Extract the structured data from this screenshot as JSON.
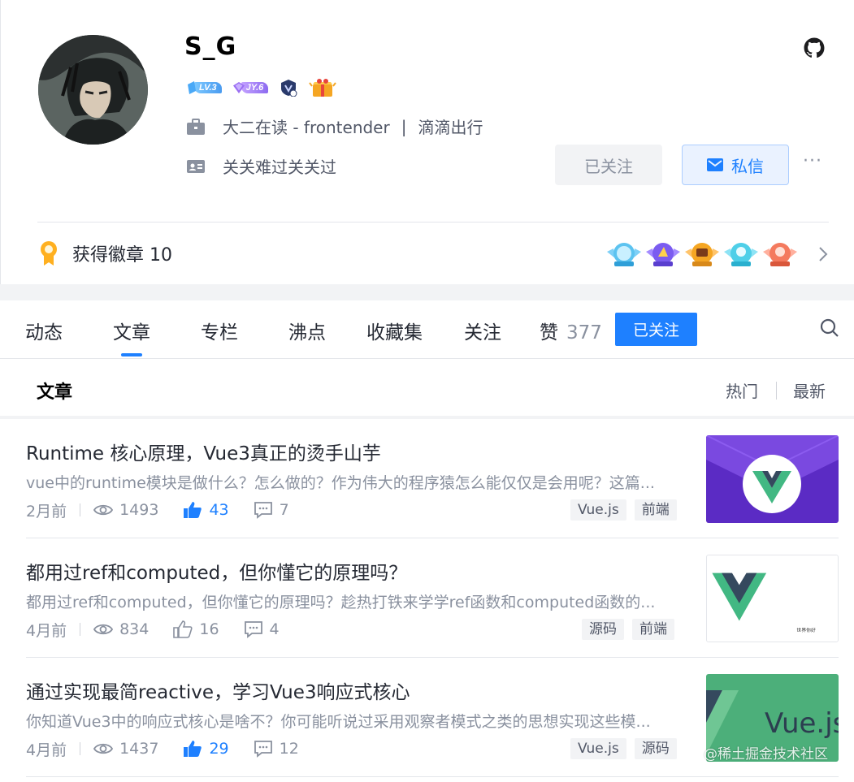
{
  "profile": {
    "username": "S_G",
    "level_badge": "LV.3",
    "jy_badge": "JY.6",
    "job": {
      "title": "大二在读 - frontender",
      "separator": "|",
      "company": "滴滴出行"
    },
    "bio": "关关难过关关过",
    "followed_label": "已关注",
    "message_label": "私信",
    "more_label": "···",
    "badges_label": "获得徽章 10"
  },
  "tabs": [
    {
      "label": "动态"
    },
    {
      "label": "文章"
    },
    {
      "label": "专栏"
    },
    {
      "label": "沸点"
    },
    {
      "label": "收藏集"
    },
    {
      "label": "关注"
    },
    {
      "label": "赞",
      "count": "377"
    }
  ],
  "tab_follow_button": "已关注",
  "list": {
    "title": "文章",
    "sort_hot": "热门",
    "sort_new": "最新"
  },
  "articles": [
    {
      "title": "Runtime 核心原理，Vue3真正的烫手山芋",
      "desc": "vue中的runtime模块是做什么？怎么做的？作为伟大的程序猿怎么能仅仅是会用呢？这篇...",
      "time": "2月前",
      "views": "1493",
      "likes": "43",
      "liked": true,
      "comments": "7",
      "tags": [
        "Vue.js",
        "前端"
      ]
    },
    {
      "title": "都用过ref和computed，但你懂它的原理吗？",
      "desc": "都用过ref和computed，但你懂它的原理吗？趁热打铁来学学ref函数和computed函数的...",
      "time": "4月前",
      "views": "834",
      "likes": "16",
      "liked": false,
      "comments": "4",
      "tags": [
        "源码",
        "前端"
      ],
      "thumb_caption": "世界你好"
    },
    {
      "title": "通过实现最简reactive，学习Vue3响应式核心",
      "desc": "你知道Vue3中的响应式核心是啥不？你可能听说过采用观察者模式之类的思想实现这些模...",
      "time": "4月前",
      "views": "1437",
      "likes": "29",
      "liked": true,
      "comments": "12",
      "tags": [
        "Vue.js",
        "源码"
      ],
      "thumb_caption": "Vue.js"
    }
  ],
  "watermark": "@稀土掘金技术社区",
  "colors": {
    "accent": "#1e80ff",
    "text_primary": "#252933",
    "text_secondary": "#8a919f",
    "vue_green": "#42b883",
    "vue_dark": "#35495e"
  }
}
